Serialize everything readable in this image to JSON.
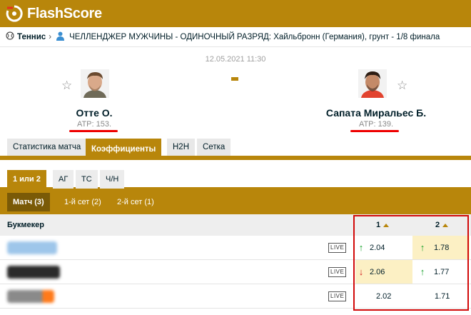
{
  "brand": {
    "name": "FlashScore"
  },
  "breadcrumb": {
    "sport": "Теннис",
    "tournament": "ЧЕЛЛЕНДЖЕР МУЖЧИНЫ - ОДИНОЧНЫЙ РАЗРЯД: Хайльбронн (Германия), грунт - 1/8 финала"
  },
  "match": {
    "datetime": "12.05.2021 11:30",
    "home": {
      "name": "Отте О.",
      "rank": "ATP: 153."
    },
    "away": {
      "name": "Сапата Миральес Б.",
      "rank": "ATP: 139."
    }
  },
  "tabs_main": [
    "Статистика матча",
    "Коэффициенты",
    "H2H",
    "Сетка"
  ],
  "tabs_market": [
    "1 или 2",
    "АГ",
    "ТС",
    "Ч/Н"
  ],
  "tabs_period": [
    "Матч (3)",
    "1-й сет (2)",
    "2-й сет (1)"
  ],
  "table": {
    "bookmaker_header": "Букмекер",
    "col1": "1",
    "col2": "2",
    "live_label": "LIVE",
    "rows": [
      {
        "odd1": "2.04",
        "odd2": "1.78",
        "dir1": "↑",
        "dir2": "↑"
      },
      {
        "odd1": "2.06",
        "odd2": "1.77",
        "dir1": "↓",
        "dir2": "↑"
      },
      {
        "odd1": "2.02",
        "odd2": "1.71",
        "dir1": "",
        "dir2": ""
      }
    ]
  },
  "colors": {
    "accent": "#b8860b",
    "highlight": "#fcf0c4",
    "up": "#18a12a",
    "down": "#d21f1f",
    "annotation": "#d20a0a"
  }
}
